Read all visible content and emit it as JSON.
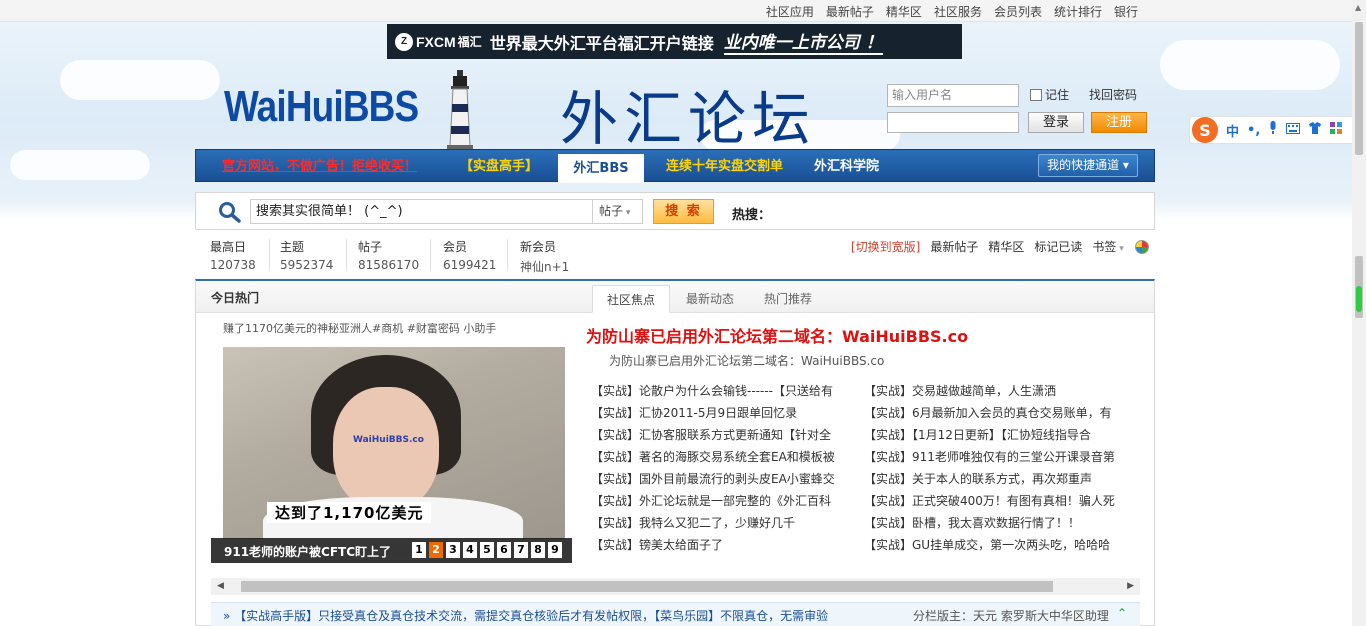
{
  "toplinks": [
    "社区应用",
    "最新帖子",
    "精华区",
    "社区服务",
    "会员列表",
    "统计排行",
    "银行"
  ],
  "banner": {
    "brand": "FXCM",
    "brand_cn": "福汇",
    "text": "世界最大外汇平台福汇开户链接",
    "slogan": "业内唯一上市公司 ！"
  },
  "site": {
    "logo": "WaiHuiBBS",
    "title": "外汇论坛"
  },
  "login": {
    "username_placeholder": "输入用户名",
    "remember": "记住",
    "forgot": "找回密码",
    "login_btn": "登录",
    "register_btn": "注册"
  },
  "ime": {
    "logo": "S",
    "items": [
      "中",
      "•,",
      "🎤",
      "⌨",
      "👕",
      "▦"
    ]
  },
  "nav": {
    "official": "官方网站，不做广告！拒绝收买！",
    "real": "【实盘高手】",
    "bbs": "外汇BBS",
    "ten_years": "连续十年实盘交割单",
    "academy": "外汇科学院",
    "quick": "我的快捷通道"
  },
  "search": {
    "value": "搜索其实很简单！ (^_^)",
    "type": "帖子",
    "button": "搜 索",
    "hot_label": "热搜："
  },
  "stats": [
    {
      "label": "最高日",
      "value": "120738"
    },
    {
      "label": "主题",
      "value": "5952374"
    },
    {
      "label": "帖子",
      "value": "81586170"
    },
    {
      "label": "会员",
      "value": "6199421"
    },
    {
      "label": "新会员",
      "value": "神仙n+1"
    }
  ],
  "rightlinks": {
    "wide": "[切换到宽版]",
    "latest": "最新帖子",
    "digest": "精华区",
    "mark_read": "标记已读",
    "bookmark": "书签"
  },
  "panel": {
    "title": "今日热门",
    "tabs": [
      "社区焦点",
      "最新动态",
      "热门推荐"
    ],
    "slide_caption_top": "赚了1170亿美元的神秘亚洲人#商机 #财富密码 小助手",
    "slide_subtitle": "达到了1,170亿美元",
    "slide_watermark": "WaiHuiBBS.co",
    "slide_title": "911老师的账户被CFTC盯上了",
    "pager": [
      "1",
      "2",
      "3",
      "4",
      "5",
      "6",
      "7",
      "8",
      "9"
    ],
    "pager_current": "2",
    "headline": "为防山寨已启用外汇论坛第二域名：WaiHuiBBS.co",
    "subline": "为防山寨已启用外汇论坛第二域名：WaiHuiBBS.co",
    "list_left": [
      "【实战】论散户为什么会输钱------【只送给有",
      "【实战】汇协2011-5月9日跟单回忆录",
      "【实战】汇协客服联系方式更新通知【针对全",
      "【实战】著名的海豚交易系统全套EA和模板被",
      "【实战】国外目前最流行的剥头皮EA小蜜蜂交",
      "【实战】外汇论坛就是一部完整的《外汇百科",
      "【实战】我特么又犯二了，少赚好几千",
      "【实战】镑美太给面子了"
    ],
    "list_right": [
      "【实战】交易越做越简单，人生潇洒",
      "【实战】6月最新加入会员的真仓交易账单，有",
      "【实战】【1月12日更新】【汇协短线指导合",
      "【实战】911老师唯独仅有的三堂公开课录音第",
      "【实战】关于本人的联系方式，再次郑重声",
      "【实战】正式突破400万！有图有真相！骗人死",
      "【实战】卧槽，我太喜欢数据行情了！！",
      "【实战】GU挂单成交，第一次两头吃，哈哈哈"
    ]
  },
  "notice": {
    "text": "【实战高手版】只接受真仓及真仓技术交流，需提交真仓核验后才有发帖权限，【菜鸟乐园】不限真仓，无需审验",
    "moderators": "分栏版主：天元 索罗斯大中华区助理"
  },
  "colors": {
    "nav_blue": "#1a4f94",
    "accent_orange": "#f18a00",
    "headline_red": "#e01010"
  }
}
